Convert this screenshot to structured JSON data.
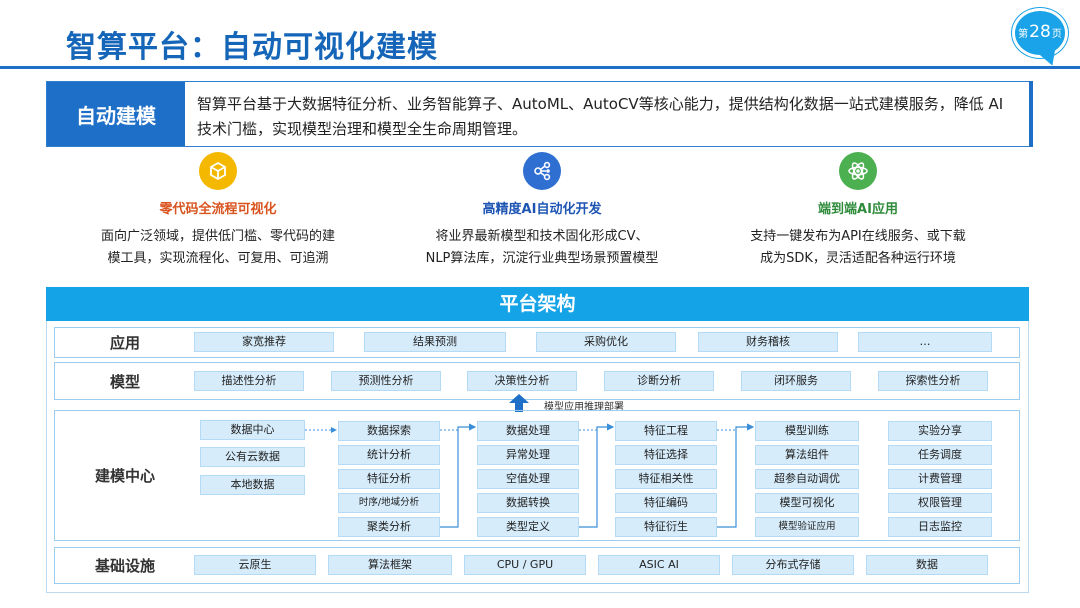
{
  "header": {
    "title": "智算平台：自动可视化建模",
    "page_prefix": "第",
    "page_number": "28",
    "page_suffix": "页"
  },
  "intro": {
    "label": "自动建模",
    "text": "智算平台基于大数据特征分析、业务智能算子、AutoML、AutoCV等核心能力，提供结构化数据一站式建模服务，降低 AI 技术门槛，实现模型治理和模型全生命周期管理。"
  },
  "features": [
    {
      "icon": "cube-icon",
      "color": "#f5b800",
      "title_color": "#d9531e",
      "title": "零代码全流程可视化",
      "desc_line1": "面向广泛领域，提供低门槛、零代码的建",
      "desc_line2": "模工具，实现流程化、可复用、可追溯"
    },
    {
      "icon": "share-nodes-icon",
      "color": "#2f6fd1",
      "title_color": "#1e55b3",
      "title": "高精度AI自动化开发",
      "desc_line1": "将业界最新模型和技术固化形成CV、",
      "desc_line2": "NLP算法库，沉淀行业典型场景预置模型"
    },
    {
      "icon": "atom-icon",
      "color": "#4caf50",
      "title_color": "#2e8b3a",
      "title": "端到端AI应用",
      "desc_line1": "支持一键发布为API在线服务、或下载",
      "desc_line2": "成为SDK，灵活适配各种运行环境"
    }
  ],
  "architecture": {
    "title": "平台架构",
    "application": {
      "label": "应用",
      "items": [
        "家宽推荐",
        "结果预测",
        "采购优化",
        "财务稽核",
        "…"
      ]
    },
    "model": {
      "label": "模型",
      "items": [
        "描述性分析",
        "预测性分析",
        "决策性分析",
        "诊断分析",
        "闭环服务",
        "探索性分析"
      ]
    },
    "deploy_label": "模型应用推理部署",
    "modeling": {
      "label": "建模中心",
      "data_sources": [
        "数据中心",
        "公有云数据",
        "本地数据"
      ],
      "exploration": [
        "数据探索",
        "统计分析",
        "特征分析",
        "时序/地域分析",
        "聚类分析"
      ],
      "processing": [
        "数据处理",
        "异常处理",
        "空值处理",
        "数据转换",
        "类型定义"
      ],
      "feature_engineering": [
        "特征工程",
        "特征选择",
        "特征相关性",
        "特征编码",
        "特征衍生"
      ],
      "training": [
        "模型训练",
        "算法组件",
        "超参自动调优",
        "模型可视化",
        "模型验证应用"
      ],
      "management": [
        "实验分享",
        "任务调度",
        "计费管理",
        "权限管理",
        "日志监控"
      ]
    },
    "infrastructure": {
      "label": "基础设施",
      "items": [
        "云原生",
        "算法框架",
        "CPU / GPU",
        "ASIC AI",
        "分布式存储",
        "数据"
      ]
    }
  },
  "colors": {
    "brand_blue": "#1e6fc7",
    "header_cyan": "#14a3e7",
    "cell_fill": "#d6ecfb"
  }
}
